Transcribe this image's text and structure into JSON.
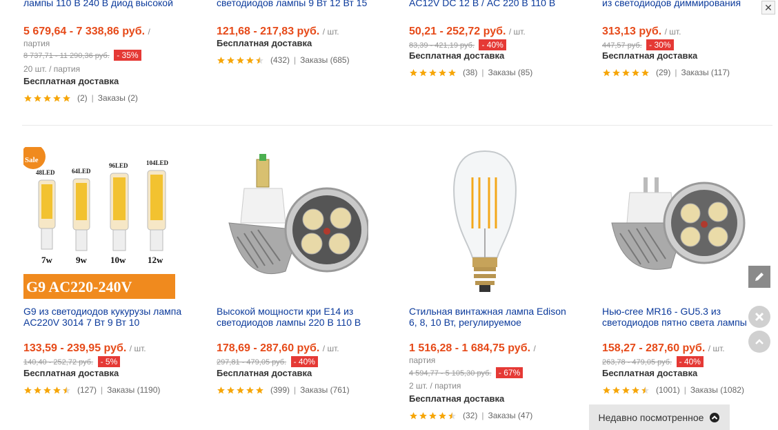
{
  "top_row": [
    {
      "title": "лампы 110 В 240 В диод высокой",
      "price": "5 679,64 - 7 338,86 руб.",
      "unit": "/",
      "unit2": "партия",
      "old": "8 737,71 - 11 290,36 руб.",
      "discount": "- 35%",
      "lot": "20 шт. / партия",
      "ship": "Бесплатная доставка",
      "reviews": "(2)",
      "orders": "Заказы (2)",
      "rating": 5
    },
    {
      "title": "светодиодов лампы 9 Вт 12 Вт 15",
      "price": "121,68 - 217,83 руб.",
      "unit": "/ шт.",
      "ship": "Бесплатная доставка",
      "reviews": "(432)",
      "orders": "Заказы (685)",
      "rating": 4.5
    },
    {
      "title": "AC12V DC 12 В / AC 220 В 110 В",
      "price": "50,21 - 252,72 руб.",
      "unit": "/ шт.",
      "old": "83,39 - 421,19 руб.",
      "discount": "- 40%",
      "ship": "Бесплатная доставка",
      "reviews": "(38)",
      "orders": "Заказы (85)",
      "rating": 5
    },
    {
      "title": "из светодиодов диммирования",
      "price": "313,13 руб.",
      "unit": "/ шт.",
      "old": "447,57 руб.",
      "discount": "- 30%",
      "ship": "Бесплатная доставка",
      "reviews": "(29)",
      "orders": "Заказы (117)",
      "rating": 5
    }
  ],
  "bottom_row": [
    {
      "title": "G9 из светодиодов кукурузы лампа AC220V 3014 7 Вт 9 Вт 10",
      "price": "133,59 - 239,95 руб.",
      "unit": "/ шт.",
      "old": "140,40 - 252,72 руб.",
      "discount": "- 5%",
      "ship": "Бесплатная доставка",
      "reviews": "(127)",
      "orders": "Заказы (1190)",
      "rating": 4.5,
      "banner": "G9 AC220-240V",
      "sale": "Sale",
      "leds": [
        "48LED",
        "64LED",
        "96LED",
        "104LED"
      ],
      "watts": [
        "7w",
        "9w",
        "10w",
        "12w"
      ]
    },
    {
      "title": "Высокой мощности кри E14 из светодиодов лампы 220 В 110 В",
      "price": "178,69 - 287,60 руб.",
      "unit": "/ шт.",
      "old": "297,81 - 479,05 руб.",
      "discount": "- 40%",
      "ship": "Бесплатная доставка",
      "reviews": "(399)",
      "orders": "Заказы (761)",
      "rating": 5
    },
    {
      "title": "Стильная винтажная лампа Edison 6, 8, 10 Вт, регулируемое",
      "price": "1 516,28 - 1 684,75 руб.",
      "unit": "/",
      "unit2": "партия",
      "old": "4 594,77 - 5 105,30 руб.",
      "discount": "- 67%",
      "lot": "2 шт. / партия",
      "ship": "Бесплатная доставка",
      "reviews": "(32)",
      "orders": "Заказы (47)",
      "rating": 4.5
    },
    {
      "title": "Нью-cree MR16 - GU5.3 из светодиодов пятно света лампы",
      "price": "158,27 - 287,60 руб.",
      "unit": "/ шт.",
      "old": "263,78 - 479,05 руб.",
      "discount": "- 40%",
      "ship": "Бесплатная доставка",
      "reviews": "(1001)",
      "orders": "Заказы (1082)",
      "rating": 4.5
    }
  ],
  "recent_label": "Недавно посмотренное",
  "icons": {
    "edit": "pencil-icon",
    "close": "close-icon",
    "up": "chevron-up-icon",
    "star": "star-icon"
  },
  "colors": {
    "price": "#e64a19",
    "discount": "#e53935",
    "link": "#0b3a9b",
    "star": "#f6a609"
  }
}
